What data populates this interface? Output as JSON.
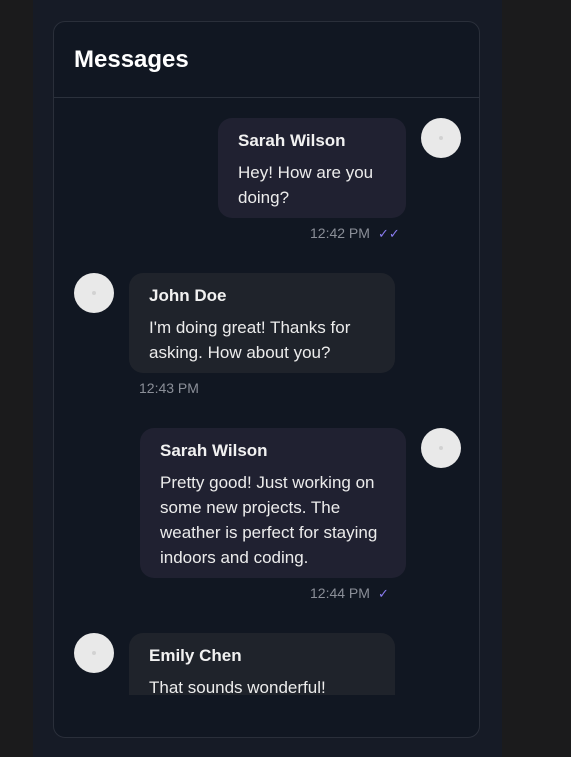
{
  "header": {
    "title": "Messages"
  },
  "messages": [
    {
      "sender": "Sarah Wilson",
      "text": "Hey! How are you doing?",
      "time": "12:42 PM",
      "status": "✓✓",
      "direction": "outgoing"
    },
    {
      "sender": "John Doe",
      "text": "I'm doing great! Thanks for asking. How about you?",
      "time": "12:43 PM",
      "direction": "incoming"
    },
    {
      "sender": "Sarah Wilson",
      "text": "Pretty good! Just working on some new projects. The weather is perfect for staying indoors and coding.",
      "time": "12:44 PM",
      "status": "✓",
      "direction": "outgoing"
    },
    {
      "sender": "Emily Chen",
      "text": "That sounds wonderful!",
      "direction": "incoming"
    }
  ],
  "colors": {
    "accent": "#8a7cf0",
    "outgoing_bubble": "#202131",
    "incoming_bubble": "#1f232b",
    "card": "#111722"
  }
}
